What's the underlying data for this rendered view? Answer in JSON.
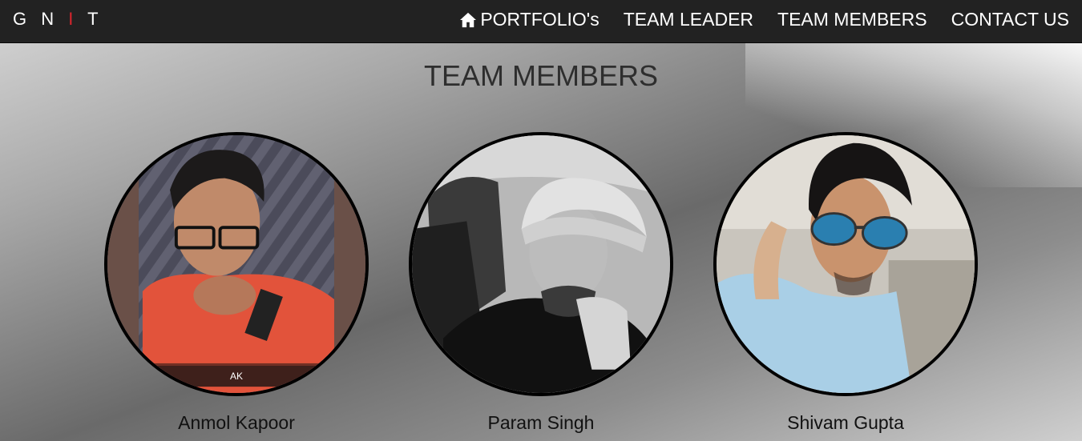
{
  "navbar": {
    "brand": {
      "pre": "G N ",
      "accent": "I",
      "post": " T"
    },
    "links": [
      {
        "label": "PORTFOLIO's",
        "icon": "home-icon"
      },
      {
        "label": "TEAM LEADER"
      },
      {
        "label": "TEAM MEMBERS"
      },
      {
        "label": "CONTACT US"
      }
    ]
  },
  "main": {
    "title": "TEAM MEMBERS",
    "members": [
      {
        "name": "Anmol Kapoor",
        "caption": "AK"
      },
      {
        "name": "Param Singh"
      },
      {
        "name": "Shivam Gupta"
      }
    ]
  },
  "colors": {
    "navbar_bg": "#222222",
    "brand_accent": "#d9262d",
    "border": "#000000"
  }
}
